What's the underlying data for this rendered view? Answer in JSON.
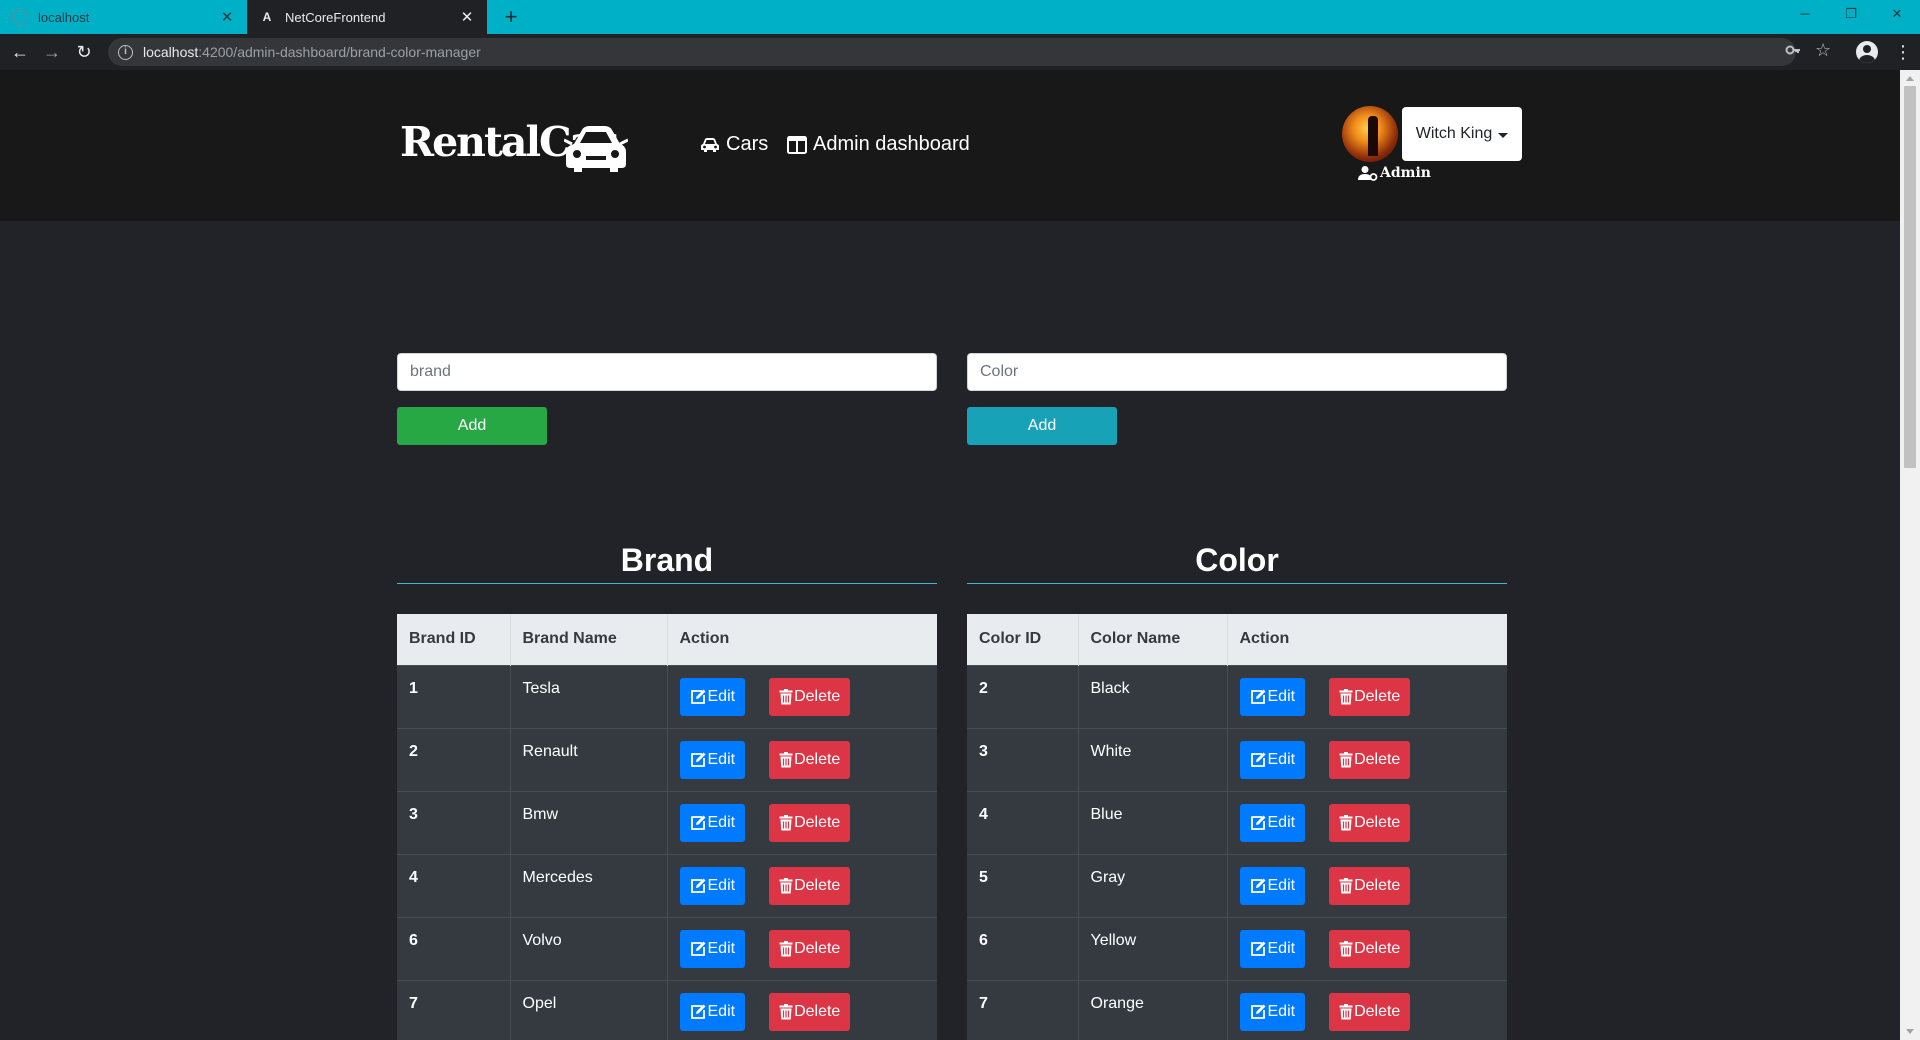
{
  "browser": {
    "tabs": [
      {
        "title": "localhost",
        "active": false
      },
      {
        "title": "NetCoreFrontend",
        "active": true
      }
    ],
    "url_host": "localhost",
    "url_path": ":4200/admin-dashboard/brand-color-manager"
  },
  "navbar": {
    "logo_text": "RentalCar",
    "links": [
      {
        "label": "Cars",
        "icon": "car-icon"
      },
      {
        "label": "Admin dashboard",
        "icon": "columns-icon"
      }
    ],
    "user_name": "Witch King",
    "role": "Admin"
  },
  "brand_form": {
    "placeholder": "brand",
    "add_label": "Add"
  },
  "color_form": {
    "placeholder": "Color",
    "add_label": "Add"
  },
  "brand_section": {
    "title": "Brand",
    "headers": [
      "Brand ID",
      "Brand Name",
      "Action"
    ],
    "rows": [
      {
        "id": "1",
        "name": "Tesla"
      },
      {
        "id": "2",
        "name": "Renault"
      },
      {
        "id": "3",
        "name": "Bmw"
      },
      {
        "id": "4",
        "name": "Mercedes"
      },
      {
        "id": "6",
        "name": "Volvo"
      },
      {
        "id": "7",
        "name": "Opel"
      }
    ]
  },
  "color_section": {
    "title": "Color",
    "headers": [
      "Color ID",
      "Color Name",
      "Action"
    ],
    "rows": [
      {
        "id": "2",
        "name": "Black"
      },
      {
        "id": "3",
        "name": "White"
      },
      {
        "id": "4",
        "name": "Blue"
      },
      {
        "id": "5",
        "name": "Gray"
      },
      {
        "id": "6",
        "name": "Yellow"
      },
      {
        "id": "7",
        "name": "Orange"
      }
    ]
  },
  "actions": {
    "edit_label": "Edit",
    "delete_label": "Delete"
  },
  "colors": {
    "tab_strip": "#00b0c6",
    "green": "#28a745",
    "teal": "#17a2b8",
    "edit": "#007bff",
    "delete": "#dc3545"
  }
}
